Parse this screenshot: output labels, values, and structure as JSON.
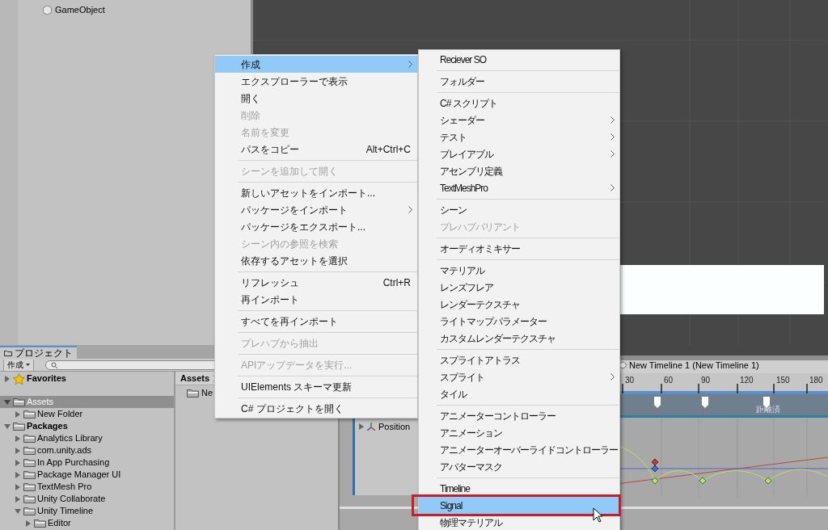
{
  "hierarchy": {
    "items": [
      {
        "label": "GameObject"
      }
    ]
  },
  "project": {
    "tab": "プロジェクト",
    "create_button": "作成",
    "tree": [
      {
        "kind": "star",
        "label": "Favorites",
        "expanded": false,
        "selected": false
      },
      {
        "kind": "folder",
        "label": "Assets",
        "expanded": true,
        "selected": true,
        "children": [
          {
            "kind": "folder",
            "label": "New Folder",
            "expanded": false,
            "selected": false
          }
        ]
      },
      {
        "kind": "folder",
        "label": "Packages",
        "expanded": true,
        "selected": false,
        "children": [
          {
            "kind": "folder",
            "label": "Analytics Library",
            "expanded": false,
            "selected": false
          },
          {
            "kind": "folder",
            "label": "com.unity.ads",
            "expanded": false,
            "selected": false
          },
          {
            "kind": "folder",
            "label": "In App Purchasing",
            "expanded": false,
            "selected": false
          },
          {
            "kind": "folder",
            "label": "Package Manager UI",
            "expanded": false,
            "selected": false
          },
          {
            "kind": "folder",
            "label": "TextMesh Pro",
            "expanded": false,
            "selected": false
          },
          {
            "kind": "folder",
            "label": "Unity Collaborate",
            "expanded": false,
            "selected": false
          },
          {
            "kind": "folder",
            "label": "Unity Timeline",
            "expanded": true,
            "selected": false,
            "children": [
              {
                "kind": "folder",
                "label": "Editor",
                "expanded": false,
                "selected": false
              }
            ]
          }
        ]
      }
    ],
    "breadcrumb": "Assets",
    "files": [
      {
        "label": "Ne"
      }
    ]
  },
  "timeline": {
    "breadcrumb": "New Timeline 1 (New Timeline 1)",
    "ruler_labels": [
      "30",
      "60",
      "90",
      "120",
      "150",
      "180"
    ],
    "track_label": "距離済",
    "property": "Position"
  },
  "context_menu": [
    {
      "kind": "item",
      "label": "作成",
      "submenu": true,
      "disabled": false,
      "selected": true
    },
    {
      "kind": "item",
      "label": "エクスプローラーで表示",
      "submenu": false,
      "disabled": false,
      "selected": false
    },
    {
      "kind": "item",
      "label": "開く",
      "submenu": false,
      "disabled": false,
      "selected": false
    },
    {
      "kind": "item",
      "label": "削除",
      "submenu": false,
      "disabled": true,
      "selected": false
    },
    {
      "kind": "item",
      "label": "名前を変更",
      "submenu": false,
      "disabled": true,
      "selected": false
    },
    {
      "kind": "item",
      "label": "パスをコピー",
      "shortcut": "Alt+Ctrl+C",
      "submenu": false,
      "disabled": false,
      "selected": false
    },
    {
      "kind": "separator"
    },
    {
      "kind": "item",
      "label": "シーンを追加して開く",
      "submenu": false,
      "disabled": true,
      "selected": false
    },
    {
      "kind": "separator"
    },
    {
      "kind": "item",
      "label": "新しいアセットをインポート...",
      "submenu": false,
      "disabled": false,
      "selected": false
    },
    {
      "kind": "item",
      "label": "パッケージをインポート",
      "submenu": true,
      "disabled": false,
      "selected": false
    },
    {
      "kind": "item",
      "label": "パッケージをエクスポート...",
      "submenu": false,
      "disabled": false,
      "selected": false
    },
    {
      "kind": "item",
      "label": "シーン内の参照を検索",
      "submenu": false,
      "disabled": true,
      "selected": false
    },
    {
      "kind": "item",
      "label": "依存するアセットを選択",
      "submenu": false,
      "disabled": false,
      "selected": false
    },
    {
      "kind": "separator"
    },
    {
      "kind": "item",
      "label": "リフレッシュ",
      "shortcut": "Ctrl+R",
      "submenu": false,
      "disabled": false,
      "selected": false
    },
    {
      "kind": "item",
      "label": "再インポート",
      "submenu": false,
      "disabled": false,
      "selected": false
    },
    {
      "kind": "separator"
    },
    {
      "kind": "item",
      "label": "すべてを再インポート",
      "submenu": false,
      "disabled": false,
      "selected": false
    },
    {
      "kind": "separator"
    },
    {
      "kind": "item",
      "label": "プレハブから抽出",
      "submenu": false,
      "disabled": true,
      "selected": false
    },
    {
      "kind": "separator"
    },
    {
      "kind": "item",
      "label": "APIアップデータを実行...",
      "submenu": false,
      "disabled": true,
      "selected": false
    },
    {
      "kind": "separator"
    },
    {
      "kind": "item",
      "label": "UIElements スキーマ更新",
      "submenu": false,
      "disabled": false,
      "selected": false
    },
    {
      "kind": "separator"
    },
    {
      "kind": "item",
      "label": "C# プロジェクトを開く",
      "submenu": false,
      "disabled": false,
      "selected": false
    }
  ],
  "create_submenu": [
    {
      "kind": "item",
      "label": "Reciever SO",
      "submenu": false,
      "disabled": false,
      "selected": false,
      "boxed": false
    },
    {
      "kind": "separator"
    },
    {
      "kind": "item",
      "label": "フォルダー",
      "submenu": false,
      "disabled": false,
      "selected": false,
      "boxed": false
    },
    {
      "kind": "separator"
    },
    {
      "kind": "item",
      "label": "C# スクリプト",
      "submenu": false,
      "disabled": false,
      "selected": false,
      "boxed": false
    },
    {
      "kind": "item",
      "label": "シェーダー",
      "submenu": true,
      "disabled": false,
      "selected": false,
      "boxed": false
    },
    {
      "kind": "item",
      "label": "テスト",
      "submenu": true,
      "disabled": false,
      "selected": false,
      "boxed": false
    },
    {
      "kind": "item",
      "label": "プレイアブル",
      "submenu": true,
      "disabled": false,
      "selected": false,
      "boxed": false
    },
    {
      "kind": "item",
      "label": "アセンブリ定義",
      "submenu": false,
      "disabled": false,
      "selected": false,
      "boxed": false
    },
    {
      "kind": "item",
      "label": "TextMeshPro",
      "submenu": true,
      "disabled": false,
      "selected": false,
      "boxed": false
    },
    {
      "kind": "separator"
    },
    {
      "kind": "item",
      "label": "シーン",
      "submenu": false,
      "disabled": false,
      "selected": false,
      "boxed": false
    },
    {
      "kind": "item",
      "label": "プレハブバリアント",
      "submenu": false,
      "disabled": true,
      "selected": false,
      "boxed": false
    },
    {
      "kind": "separator"
    },
    {
      "kind": "item",
      "label": "オーディオミキサー",
      "submenu": false,
      "disabled": false,
      "selected": false,
      "boxed": false
    },
    {
      "kind": "separator"
    },
    {
      "kind": "item",
      "label": "マテリアル",
      "submenu": false,
      "disabled": false,
      "selected": false,
      "boxed": false
    },
    {
      "kind": "item",
      "label": "レンズフレア",
      "submenu": false,
      "disabled": false,
      "selected": false,
      "boxed": false
    },
    {
      "kind": "item",
      "label": "レンダーテクスチャ",
      "submenu": false,
      "disabled": false,
      "selected": false,
      "boxed": false
    },
    {
      "kind": "item",
      "label": "ライトマップパラメーター",
      "submenu": false,
      "disabled": false,
      "selected": false,
      "boxed": false
    },
    {
      "kind": "item",
      "label": "カスタムレンダーテクスチャ",
      "submenu": false,
      "disabled": false,
      "selected": false,
      "boxed": false
    },
    {
      "kind": "separator"
    },
    {
      "kind": "item",
      "label": "スプライトアトラス",
      "submenu": false,
      "disabled": false,
      "selected": false,
      "boxed": false
    },
    {
      "kind": "item",
      "label": "スプライト",
      "submenu": true,
      "disabled": false,
      "selected": false,
      "boxed": false
    },
    {
      "kind": "item",
      "label": "タイル",
      "submenu": false,
      "disabled": false,
      "selected": false,
      "boxed": false
    },
    {
      "kind": "separator"
    },
    {
      "kind": "item",
      "label": "アニメーターコントローラー",
      "submenu": false,
      "disabled": false,
      "selected": false,
      "boxed": false
    },
    {
      "kind": "item",
      "label": "アニメーション",
      "submenu": false,
      "disabled": false,
      "selected": false,
      "boxed": false
    },
    {
      "kind": "item",
      "label": "アニメーターオーバーライドコントローラー",
      "submenu": false,
      "disabled": false,
      "selected": false,
      "boxed": false
    },
    {
      "kind": "item",
      "label": "アバターマスク",
      "submenu": false,
      "disabled": false,
      "selected": false,
      "boxed": false
    },
    {
      "kind": "separator"
    },
    {
      "kind": "item",
      "label": "Timeline",
      "submenu": false,
      "disabled": false,
      "selected": false,
      "boxed": false
    },
    {
      "kind": "item",
      "label": "Signal",
      "submenu": false,
      "disabled": false,
      "selected": true,
      "boxed": true
    },
    {
      "kind": "item",
      "label": "物理マテリアル",
      "submenu": false,
      "disabled": false,
      "selected": false,
      "boxed": false
    }
  ]
}
